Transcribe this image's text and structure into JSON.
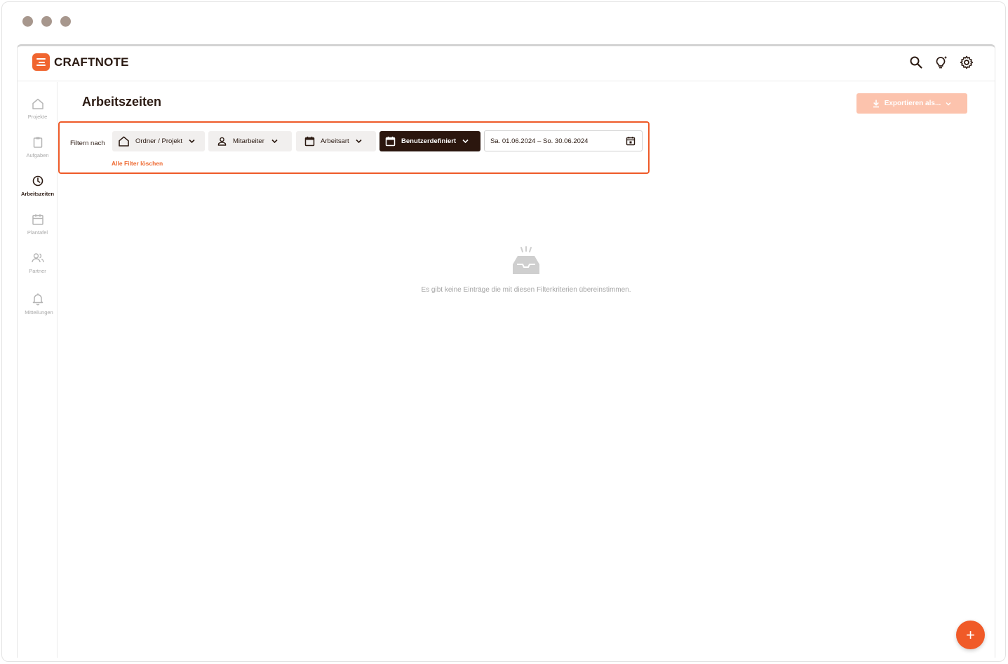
{
  "app": {
    "brand": "CRAFTNOTE",
    "accent": "#f0652f",
    "dark": "#2b160e"
  },
  "topbar": {
    "icons": [
      "search-icon",
      "lightbulb-icon",
      "gear-icon"
    ]
  },
  "sidebar": {
    "items": [
      {
        "label": "Projekte",
        "icon": "home-icon",
        "active": false
      },
      {
        "label": "Aufgaben",
        "icon": "clipboard-icon",
        "active": false
      },
      {
        "label": "Arbeitszeiten",
        "icon": "clock-icon",
        "active": true
      },
      {
        "label": "Plantafel",
        "icon": "calendar-icon",
        "active": false
      },
      {
        "label": "Partner",
        "icon": "users-icon",
        "active": false
      },
      {
        "label": "Mitteilungen",
        "icon": "bell-icon",
        "active": false
      }
    ]
  },
  "main": {
    "title": "Arbeitszeiten",
    "export_label": "Exportieren als...",
    "filter": {
      "label": "Filtern nach",
      "project": "Ordner / Projekt",
      "employee": "Mitarbeiter",
      "work_type": "Arbeitsart",
      "period": "Benutzerdefiniert",
      "date_range": "Sa. 01.06.2024 – So. 30.06.2024",
      "clear": "Alle Filter löschen"
    },
    "empty_message": "Es gibt keine Einträge die mit diesen Filterkriterien übereinstimmen.",
    "fab_label": "+"
  }
}
